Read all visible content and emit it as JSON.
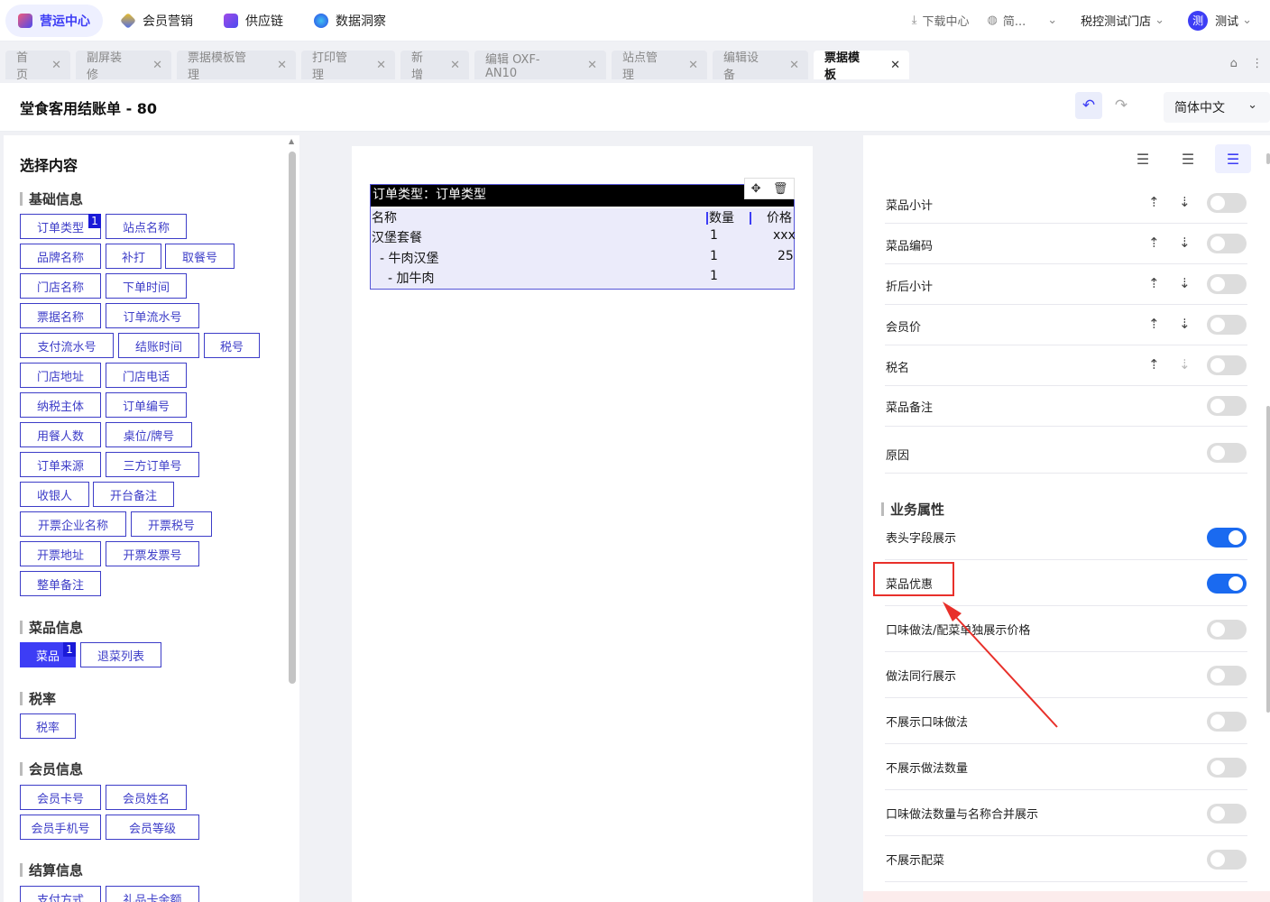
{
  "topnav": {
    "items": [
      {
        "label": "营运中心",
        "icon": "hub-icon",
        "color": "#4b4bf0"
      },
      {
        "label": "会员营销",
        "icon": "member-icon",
        "color": "#f0a020"
      },
      {
        "label": "供应链",
        "icon": "supply-icon",
        "color": "#6a4bd8"
      },
      {
        "label": "数据洞察",
        "icon": "data-icon",
        "color": "#2a78e8"
      }
    ],
    "download": "下载中心",
    "language": "简...",
    "store": "税控测试门店",
    "user_avatar": "测",
    "user_name": "测试"
  },
  "tabs": [
    {
      "label": "首页"
    },
    {
      "label": "副屏装修"
    },
    {
      "label": "票据模板管理"
    },
    {
      "label": "打印管理"
    },
    {
      "label": "新增"
    },
    {
      "label": "编辑 OXF-AN10"
    },
    {
      "label": "站点管理"
    },
    {
      "label": "编辑设备"
    },
    {
      "label": "票据模板",
      "active": true
    }
  ],
  "header": {
    "title": "堂食客用结账单 - 80",
    "lang_select": "简体中文"
  },
  "left": {
    "title": "选择内容",
    "sections": {
      "basic": "基础信息",
      "dish": "菜品信息",
      "tax": "税率",
      "member": "会员信息",
      "settle": "结算信息"
    },
    "chips": {
      "order_type": "订单类型",
      "site_name": "站点名称",
      "brand_name": "品牌名称",
      "reprint": "补打",
      "pickup_no": "取餐号",
      "store_name": "门店名称",
      "order_time": "下单时间",
      "receipt_name": "票据名称",
      "order_serial": "订单流水号",
      "pay_serial": "支付流水号",
      "checkout_time": "结账时间",
      "tax_no": "税号",
      "store_addr": "门店地址",
      "store_phone": "门店电话",
      "taxpayer": "纳税主体",
      "order_no": "订单编号",
      "diners": "用餐人数",
      "table_no": "桌位/牌号",
      "order_source": "订单来源",
      "third_order": "三方订单号",
      "cashier": "收银人",
      "open_note": "开台备注",
      "invoice_company": "开票企业名称",
      "invoice_tax": "开票税号",
      "invoice_addr": "开票地址",
      "invoice_no": "开票发票号",
      "order_note": "整单备注",
      "dish": "菜品",
      "return_list": "退菜列表",
      "tax_rate": "税率",
      "member_card": "会员卡号",
      "member_name": "会员姓名",
      "member_phone": "会员手机号",
      "member_level": "会员等级",
      "pay_method": "支付方式",
      "gift_balance": "礼品卡余额"
    },
    "badge_order_type": "1",
    "badge_dish": "1"
  },
  "ticket": {
    "head": "订单类型：订单类型",
    "col_name": "名称",
    "col_qty": "数量",
    "col_price": "价格",
    "rows": [
      {
        "name": "汉堡套餐",
        "qty": "1",
        "price": "xxx"
      },
      {
        "name": "- 牛肉汉堡",
        "qty": "1",
        "price": "25"
      },
      {
        "name": "- 加牛肉",
        "qty": "1",
        "price": ""
      }
    ]
  },
  "right": {
    "fields": [
      {
        "label": "菜品小计",
        "on": false
      },
      {
        "label": "菜品编码",
        "on": false
      },
      {
        "label": "折后小计",
        "on": false
      },
      {
        "label": "会员价",
        "on": false
      },
      {
        "label": "税名",
        "on": false
      },
      {
        "label": "菜品备注",
        "on": false
      },
      {
        "label": "原因",
        "on": false
      }
    ],
    "biz_title": "业务属性",
    "biz": [
      {
        "label": "表头字段展示",
        "on": true
      },
      {
        "label": "菜品优惠",
        "on": true
      },
      {
        "label": "口味做法/配菜单独展示价格",
        "on": false
      },
      {
        "label": "做法同行展示",
        "on": false
      },
      {
        "label": "不展示口味做法",
        "on": false
      },
      {
        "label": "不展示做法数量",
        "on": false
      },
      {
        "label": "口味做法数量与名称合并展示",
        "on": false
      },
      {
        "label": "不展示配菜",
        "on": false
      }
    ]
  },
  "colors": {
    "accent": "#3d3df5",
    "toggle_on": "#1a6af0",
    "annotation": "#e8302a"
  }
}
